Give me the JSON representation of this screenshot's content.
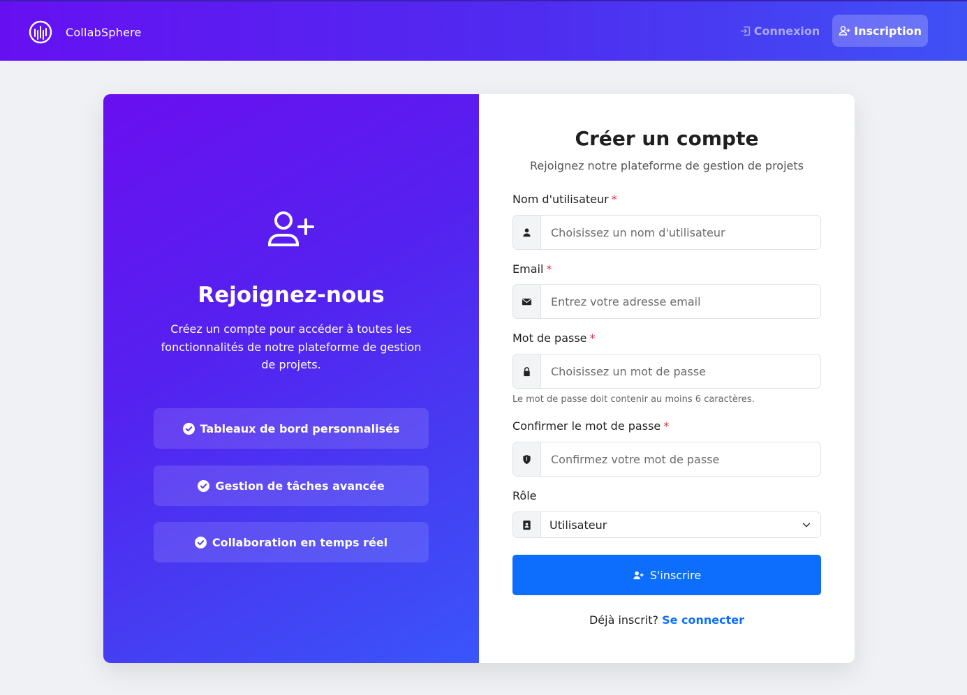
{
  "header": {
    "brand": "CollabSphere",
    "login_label": "Connexion",
    "register_label": "Inscription"
  },
  "promo": {
    "title": "Rejoignez-nous",
    "description": "Créez un compte pour accéder à toutes les fonctionnalités de notre plateforme de gestion de projets.",
    "features": [
      "Tableaux de bord personnalisés",
      "Gestion de tâches avancée",
      "Collaboration en temps réel"
    ]
  },
  "form": {
    "title": "Créer un compte",
    "subtitle": "Rejoignez notre plateforme de gestion de projets",
    "username": {
      "label": "Nom d'utilisateur",
      "placeholder": "Choisissez un nom d'utilisateur",
      "value": ""
    },
    "email": {
      "label": "Email",
      "placeholder": "Entrez votre adresse email",
      "value": ""
    },
    "password": {
      "label": "Mot de passe",
      "placeholder": "Choisissez un mot de passe",
      "value": "",
      "hint": "Le mot de passe doit contenir au moins 6 caractères."
    },
    "confirm": {
      "label": "Confirmer le mot de passe",
      "placeholder": "Confirmez votre mot de passe",
      "value": ""
    },
    "role": {
      "label": "Rôle",
      "selected": "Utilisateur"
    },
    "required_mark": "*",
    "submit_label": "S'inscrire",
    "footer_text": "Déjà inscrit?",
    "footer_link": "Se connecter"
  },
  "colors": {
    "header_gradient_start": "#6610f2",
    "header_gradient_end": "#3f51f5",
    "primary": "#0d6efd",
    "required": "#dc3545"
  },
  "icons": {
    "brand": "waveform-circle-icon",
    "login": "login-icon",
    "register": "user-plus-icon",
    "feature": "check-circle-icon",
    "username": "user-icon",
    "email": "envelope-icon",
    "password": "lock-icon",
    "confirm": "shield-icon",
    "role": "id-card-icon",
    "select": "chevron-down-icon"
  }
}
